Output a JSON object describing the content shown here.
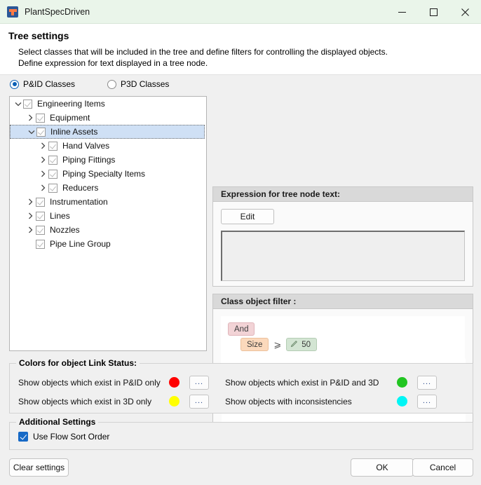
{
  "window": {
    "title": "PlantSpecDriven",
    "icon": "plant-app-icon",
    "minimize": "—",
    "maximize": "☐",
    "close": "✕"
  },
  "header": {
    "title": "Tree settings",
    "desc_line1": "Select classes that will be included in the tree and define filters for controlling the displayed objects.",
    "desc_line2": "Define expression for text displayed in a tree node."
  },
  "class_mode": {
    "options": [
      {
        "label": "P&ID Classes",
        "selected": true
      },
      {
        "label": "P3D Classes",
        "selected": false
      }
    ]
  },
  "tree": {
    "nodes": [
      {
        "label": "Engineering Items",
        "depth": 0,
        "expander": "down",
        "checked": true,
        "selected": false
      },
      {
        "label": "Equipment",
        "depth": 1,
        "expander": "right",
        "checked": true,
        "selected": false
      },
      {
        "label": "Inline Assets",
        "depth": 1,
        "expander": "down",
        "checked": true,
        "selected": true
      },
      {
        "label": "Hand Valves",
        "depth": 2,
        "expander": "right",
        "checked": true,
        "selected": false
      },
      {
        "label": "Piping Fittings",
        "depth": 2,
        "expander": "right",
        "checked": true,
        "selected": false
      },
      {
        "label": "Piping Specialty Items",
        "depth": 2,
        "expander": "right",
        "checked": true,
        "selected": false
      },
      {
        "label": "Reducers",
        "depth": 2,
        "expander": "right",
        "checked": true,
        "selected": false
      },
      {
        "label": "Instrumentation",
        "depth": 1,
        "expander": "right",
        "checked": true,
        "selected": false
      },
      {
        "label": "Lines",
        "depth": 1,
        "expander": "right",
        "checked": true,
        "selected": false
      },
      {
        "label": "Nozzles",
        "depth": 1,
        "expander": "right",
        "checked": true,
        "selected": false
      },
      {
        "label": "Pipe Line Group",
        "depth": 1,
        "expander": "none",
        "checked": true,
        "selected": false
      }
    ]
  },
  "expression_group": {
    "title": "Expression for tree node text:",
    "edit_label": "Edit",
    "text_value": ""
  },
  "filter_group": {
    "title": "Class object filter :",
    "builder": {
      "logic_chip": "And",
      "field_chip": "Size",
      "operator": "⩾",
      "value_chip": "50",
      "value_icon": "pencil-icon"
    },
    "sql": {
      "field": "[Size]",
      "operator": ">=",
      "value": "'50'"
    },
    "scroll_up": "▲",
    "scroll_down": "▼"
  },
  "colors_group": {
    "legend": "Colors for object Link Status:",
    "browse_label": "...",
    "rows": [
      {
        "label": "Show objects which exist in P&ID only",
        "color": "#FF0000"
      },
      {
        "label": "Show objects which exist in P&ID and 3D",
        "color": "#21C521"
      },
      {
        "label": "Show objects which exist in 3D only",
        "color": "#FFFF00"
      },
      {
        "label": "Show objects with inconsistencies",
        "color": "#00F5F5"
      }
    ]
  },
  "additional_group": {
    "legend": "Additional Settings",
    "flow_sort": {
      "label": "Use Flow Sort Order",
      "checked": true
    }
  },
  "footer": {
    "clear_label": "Clear settings",
    "ok_label": "OK",
    "cancel_label": "Cancel"
  }
}
